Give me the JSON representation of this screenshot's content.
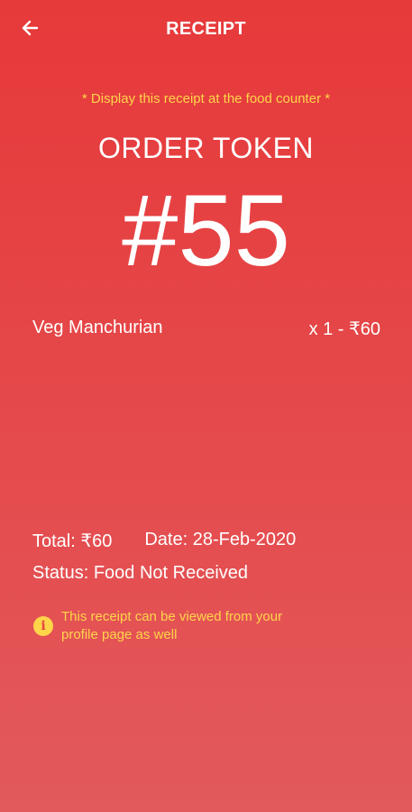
{
  "appbar": {
    "title": "RECEIPT",
    "back_icon": "arrow-left-icon"
  },
  "receipt": {
    "notice": "* Display this receipt at the food counter *",
    "token_label": "ORDER TOKEN",
    "token_number": "#55"
  },
  "items": [
    {
      "name": "Veg Manchurian",
      "qty_price": "x 1 - ₹60"
    }
  ],
  "summary": {
    "total": "Total: ₹60",
    "date": "Date: 28-Feb-2020",
    "status": "Status: Food Not Received"
  },
  "info": {
    "icon": "info-icon",
    "text": "This receipt can be viewed from your profile page as well"
  },
  "colors": {
    "background_top": "#e6393a",
    "background_bottom": "#e25a5c",
    "accent_yellow": "#ffd54a",
    "text": "#ffffff"
  }
}
